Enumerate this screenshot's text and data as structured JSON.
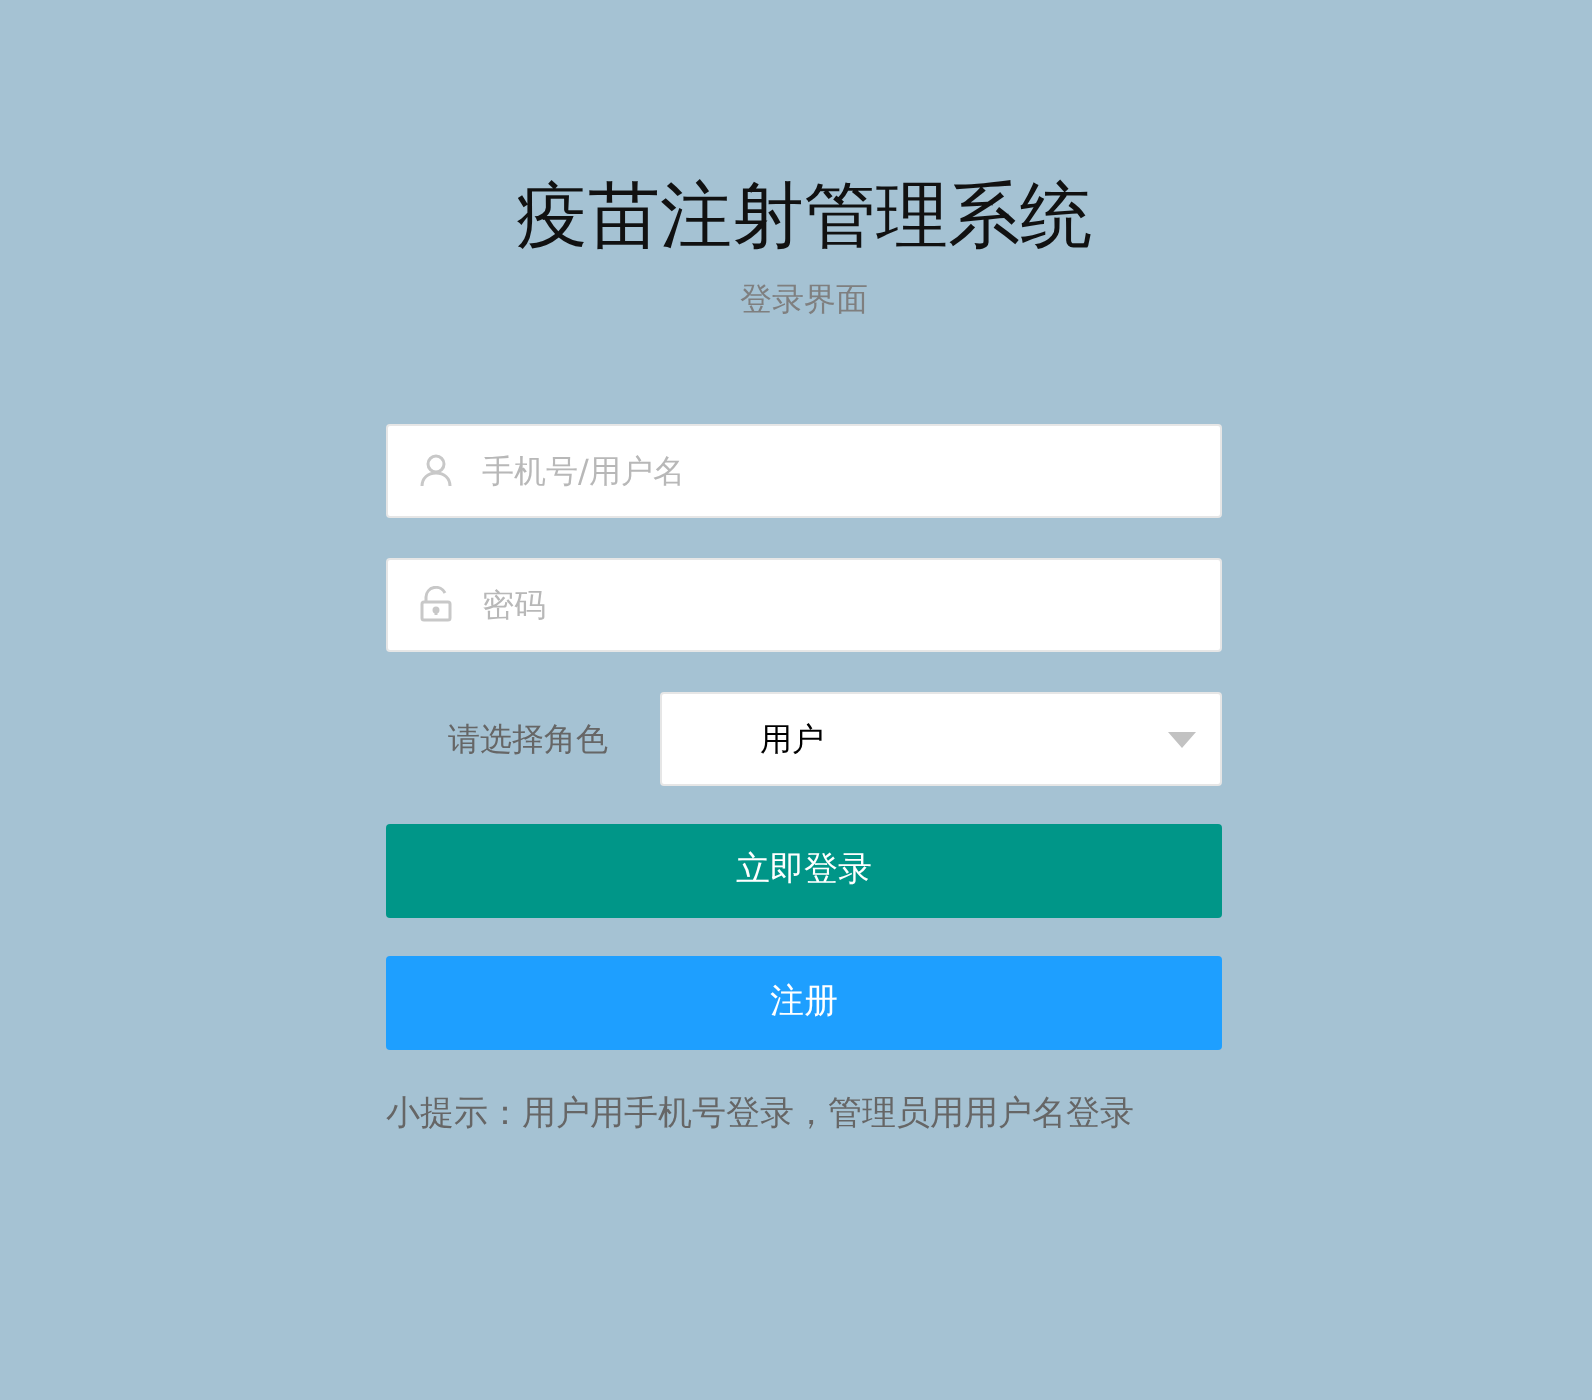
{
  "title": "疫苗注射管理系统",
  "subtitle": "登录界面",
  "fields": [
    {
      "kind": "user",
      "placeholder": "手机号/用户名"
    },
    {
      "kind": "password",
      "placeholder": "密码"
    }
  ],
  "role": {
    "label": "请选择角色",
    "value": "用户"
  },
  "buttons": [
    {
      "kind": "primary",
      "label": "立即登录"
    },
    {
      "kind": "secondary",
      "label": "注册"
    }
  ],
  "hint": "小提示：用户用手机号登录，管理员用用户名登录"
}
